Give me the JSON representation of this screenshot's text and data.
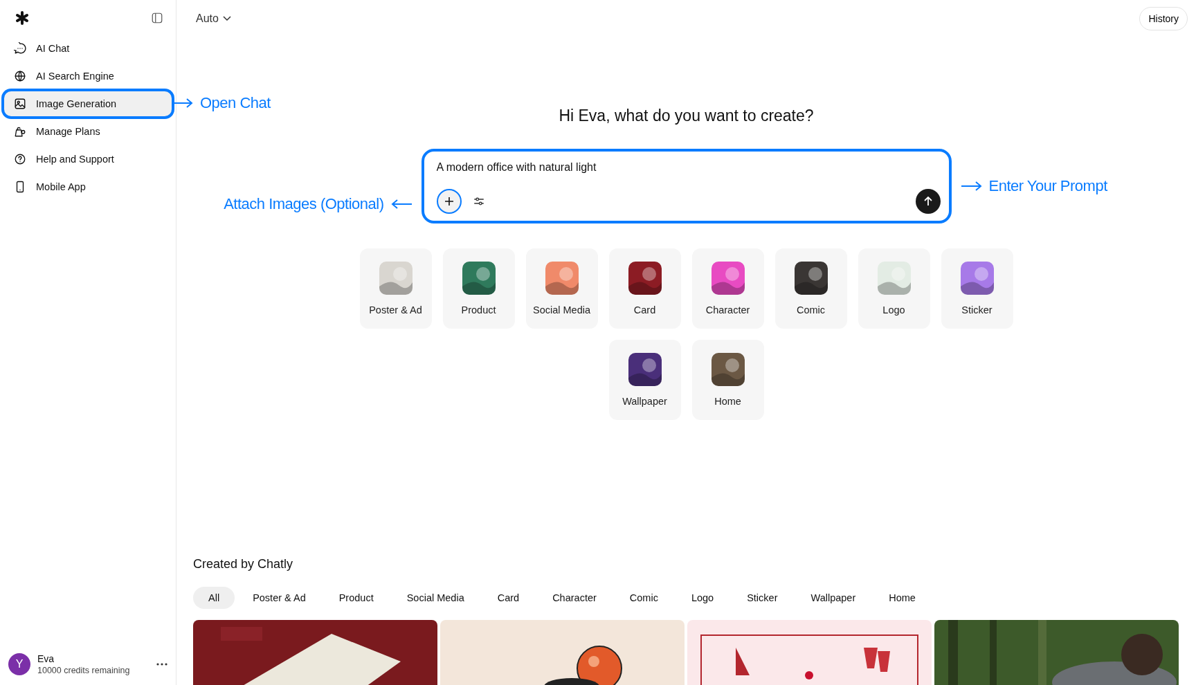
{
  "sidebar": {
    "items": [
      {
        "label": "AI Chat",
        "selected": false,
        "highlighted": false
      },
      {
        "label": "AI Search Engine",
        "selected": false,
        "highlighted": false
      },
      {
        "label": "Image Generation",
        "selected": true,
        "highlighted": true
      },
      {
        "label": "Manage Plans",
        "selected": false,
        "highlighted": false
      },
      {
        "label": "Help and Support",
        "selected": false,
        "highlighted": false
      },
      {
        "label": "Mobile App",
        "selected": false,
        "highlighted": false
      }
    ],
    "user": {
      "initial": "Y",
      "name": "Eva",
      "credits": "10000 credits remaining"
    }
  },
  "topbar": {
    "model": "Auto",
    "history": "History"
  },
  "heading": "Hi Eva, what do you want to create?",
  "prompt": {
    "value": "A modern office with natural light",
    "highlighted": true
  },
  "annotations": [
    {
      "kind": "right",
      "text": "Open Chat"
    },
    {
      "kind": "left",
      "text": "Attach Images (Optional)"
    },
    {
      "kind": "right",
      "text": "Enter Your Prompt"
    }
  ],
  "categories": [
    {
      "label": "Poster & Ad"
    },
    {
      "label": "Product"
    },
    {
      "label": "Social Media"
    },
    {
      "label": "Card"
    },
    {
      "label": "Character"
    },
    {
      "label": "Comic"
    },
    {
      "label": "Logo"
    },
    {
      "label": "Sticker"
    },
    {
      "label": "Wallpaper"
    },
    {
      "label": "Home"
    }
  ],
  "gallery": {
    "title": "Created by Chatly",
    "filters": [
      {
        "label": "All",
        "selected": true
      },
      {
        "label": "Poster & Ad",
        "selected": false
      },
      {
        "label": "Product",
        "selected": false
      },
      {
        "label": "Social Media",
        "selected": false
      },
      {
        "label": "Card",
        "selected": false
      },
      {
        "label": "Character",
        "selected": false
      },
      {
        "label": "Comic",
        "selected": false
      },
      {
        "label": "Logo",
        "selected": false
      },
      {
        "label": "Sticker",
        "selected": false
      },
      {
        "label": "Wallpaper",
        "selected": false
      },
      {
        "label": "Home",
        "selected": false
      }
    ]
  }
}
